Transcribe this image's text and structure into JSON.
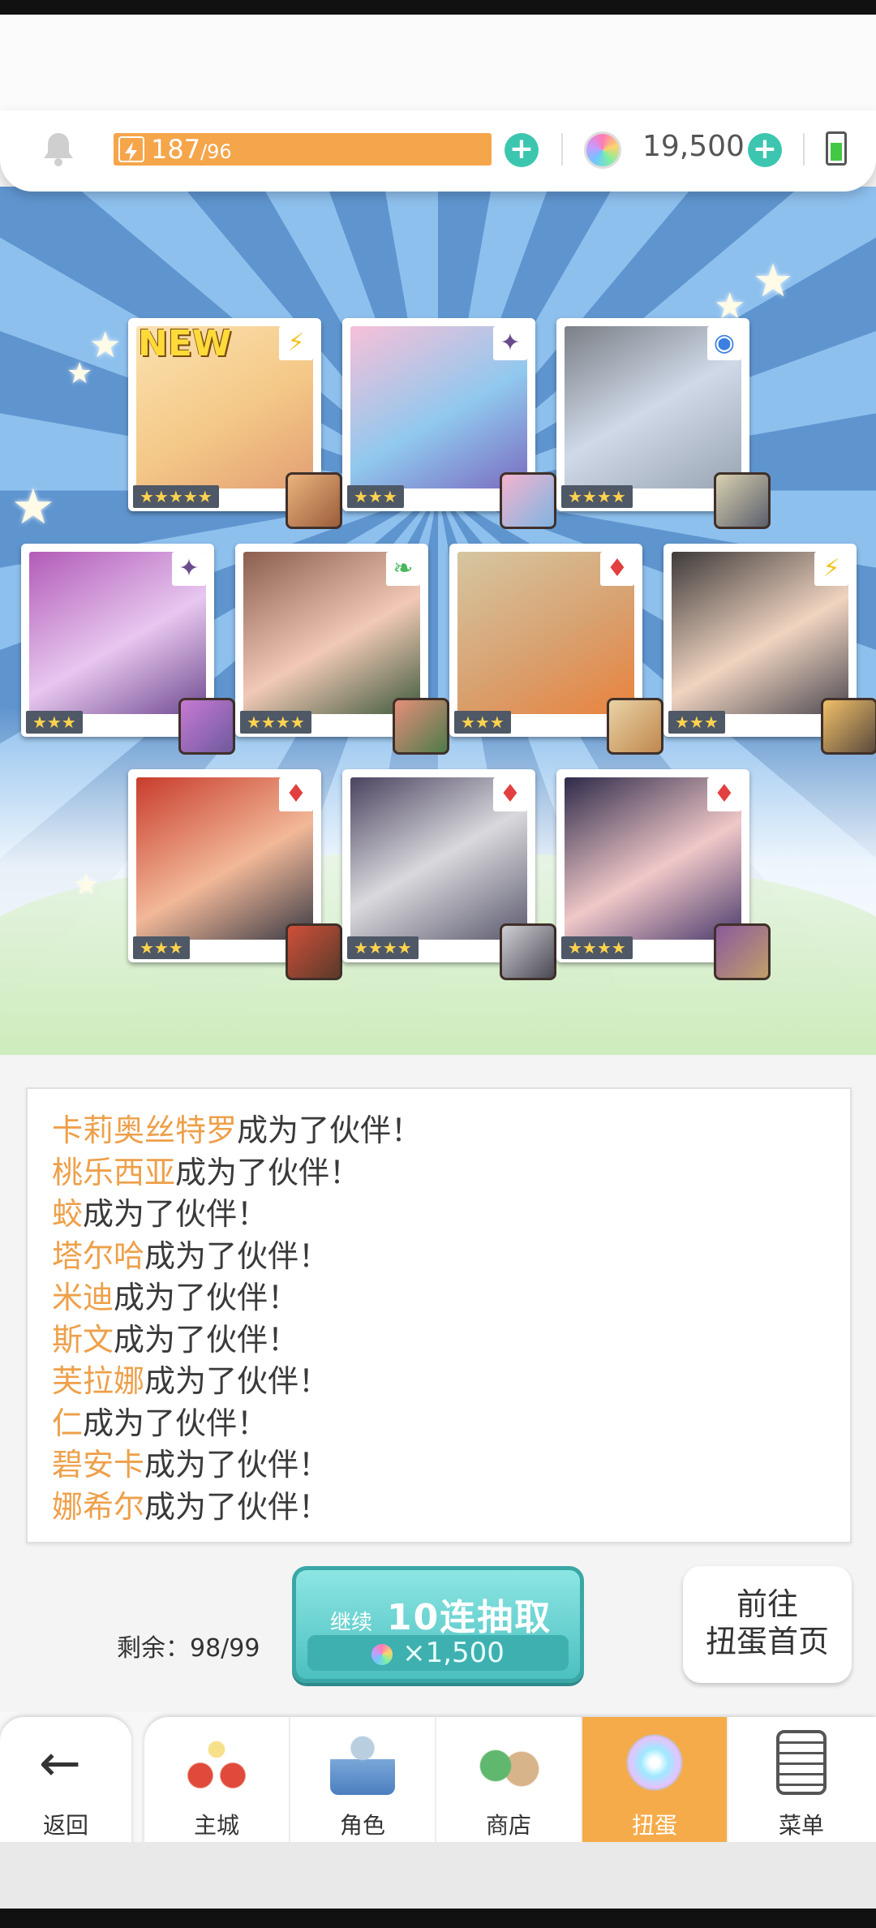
{
  "status": {
    "energy_current": "187",
    "energy_max": "/96",
    "gems": "19,500"
  },
  "cards": [
    {
      "rarity": "★★★★★",
      "attr": "⚡",
      "new_label": "NEW"
    },
    {
      "rarity": "★★★",
      "attr": "✦"
    },
    {
      "rarity": "★★★★",
      "attr": "◉"
    },
    {
      "rarity": "★★★",
      "attr": "✦"
    },
    {
      "rarity": "★★★★",
      "attr": "❧"
    },
    {
      "rarity": "★★★",
      "attr": "♦"
    },
    {
      "rarity": "★★★",
      "attr": "⚡"
    },
    {
      "rarity": "★★★",
      "attr": "♦"
    },
    {
      "rarity": "★★★★",
      "attr": "♦"
    },
    {
      "rarity": "★★★★",
      "attr": "♦"
    }
  ],
  "log": {
    "suffix": "成为了伙伴！",
    "names": [
      "卡莉奥丝特罗",
      "桃乐西亚",
      "蛟",
      "塔尔哈",
      "米迪",
      "斯文",
      "芙拉娜",
      "仁",
      "碧安卡",
      "娜希尔"
    ]
  },
  "actions": {
    "remaining": "剩余：98/99",
    "draw_continue": "继续",
    "draw_title": "10连抽取",
    "draw_cost": "×1,500",
    "gacha_home": "前往\n扭蛋首页"
  },
  "nav": {
    "back": "返回",
    "tabs": [
      "主城",
      "角色",
      "商店",
      "扭蛋",
      "菜单"
    ],
    "active_tab": "扭蛋"
  }
}
